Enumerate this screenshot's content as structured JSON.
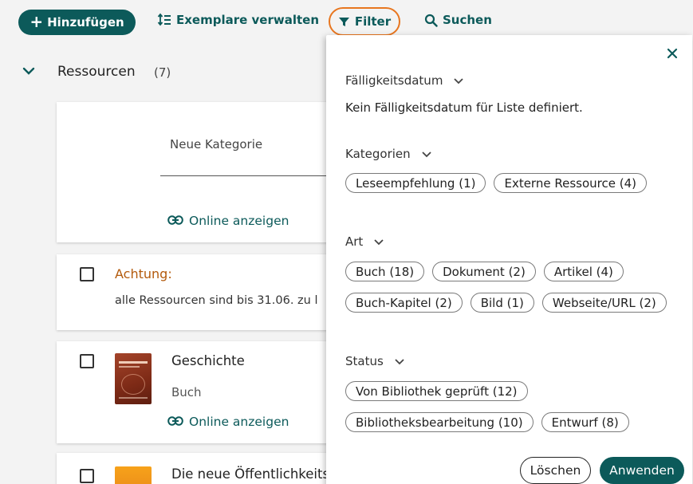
{
  "toolbar": {
    "add_label": "Hinzufügen",
    "copies_label": "Exemplare verwalten",
    "filter_label": "Filter",
    "search_label": "Suchen"
  },
  "section": {
    "title": "Ressourcen",
    "count": "(7)"
  },
  "cards": {
    "category_placeholder": "Neue Kategorie",
    "online_label": "Online anzeigen",
    "warning_title": "Achtung:",
    "warning_text": "alle Ressourcen sind bis 31.06. zu l",
    "item1_title": "Geschichte",
    "item1_type": "Buch",
    "item2_title": "Die neue Öffentlichkeits"
  },
  "filter_panel": {
    "due_date": {
      "heading": "Fälligkeitsdatum",
      "text": "Kein Fälligkeitsdatum für Liste definiert."
    },
    "categories": {
      "heading": "Kategorien",
      "chips": [
        "Leseempfehlung (1)",
        "Externe Ressource (4)"
      ]
    },
    "type": {
      "heading": "Art",
      "chips_row1": [
        "Buch (18)",
        "Dokument (2)",
        "Artikel (4)"
      ],
      "chips_row2": [
        "Buch-Kapitel (2)",
        "Bild (1)",
        "Webseite/URL (2)"
      ]
    },
    "status": {
      "heading": "Status",
      "chips_row1": [
        "Von Bibliothek geprüft (12)"
      ],
      "chips_row2": [
        "Bibliotheksbearbeitung (10)",
        "Entwurf (8)"
      ]
    },
    "clear_label": "Löschen",
    "apply_label": "Anwenden"
  },
  "colors": {
    "accent": "#0c5a5a",
    "highlight": "#e8761f",
    "warning": "#b35a0c"
  }
}
